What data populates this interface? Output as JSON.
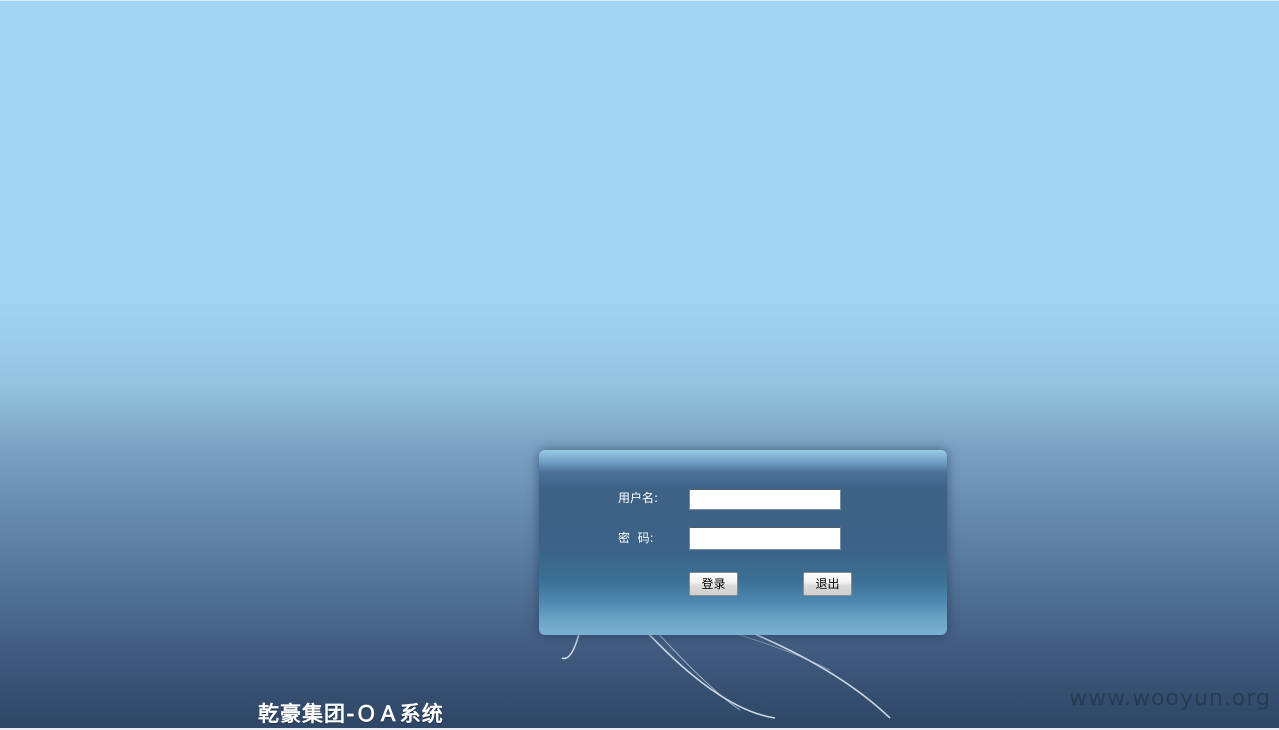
{
  "login_form": {
    "username_label": "用户名:",
    "username_value": "",
    "password_label": "密  码:",
    "password_value": "",
    "login_button": "登录",
    "exit_button": "退出"
  },
  "footer": {
    "system_title": "乾豪集团-ＯＡ系统"
  },
  "watermark": {
    "text": "www.wooyun.org"
  },
  "colors": {
    "sky_top": "#a2d4f2",
    "sky_bottom": "#2f4666",
    "panel_body": "#3b6387",
    "panel_highlight": "#9ccbe6",
    "label_text": "#ffffff"
  }
}
